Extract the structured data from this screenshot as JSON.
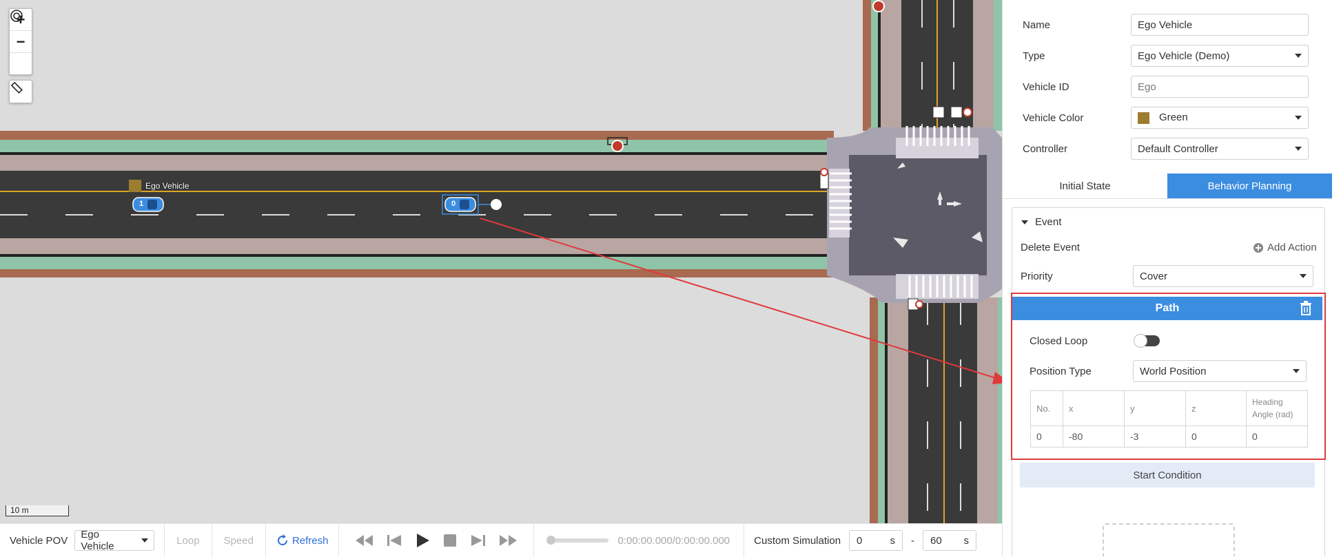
{
  "map": {
    "zoom_in": "+",
    "zoom_out": "−",
    "scale_label": "10 m",
    "ego_label": "Ego Vehicle",
    "vehicle_numbers": [
      "1",
      "0"
    ]
  },
  "bottom_bar": {
    "pov_label": "Vehicle POV",
    "pov_value": "Ego Vehicle",
    "loop_label": "Loop",
    "speed_label": "Speed",
    "refresh_label": "Refresh",
    "time_display": "0:00:00.000/0:00:00.000",
    "custom_sim_label": "Custom Simulation",
    "start_value": "0",
    "start_unit": "s",
    "separator": "-",
    "end_value": "60",
    "end_unit": "s",
    "progress": 0
  },
  "panel": {
    "name_label": "Name",
    "name_value": "Ego Vehicle",
    "type_label": "Type",
    "type_value": "Ego Vehicle (Demo)",
    "vehicle_id_label": "Vehicle ID",
    "vehicle_id_placeholder": "Ego",
    "vehicle_color_label": "Vehicle Color",
    "vehicle_color_value": "Green",
    "vehicle_color_hex": "#9c7c2e",
    "controller_label": "Controller",
    "controller_value": "Default Controller",
    "tabs": [
      {
        "label": "Initial State",
        "active": false
      },
      {
        "label": "Behavior Planning",
        "active": true
      }
    ],
    "event_label": "Event",
    "delete_event_label": "Delete Event",
    "add_action_label": "Add Action",
    "priority_label": "Priority",
    "priority_value": "Cover",
    "path_title": "Path",
    "closed_loop_label": "Closed Loop",
    "closed_loop_on": false,
    "position_type_label": "Position Type",
    "position_type_value": "World Position",
    "table_headers": [
      "No.",
      "x",
      "y",
      "z",
      "Heading Angle (rad)"
    ],
    "table_rows": [
      [
        "0",
        "-80",
        "-3",
        "0",
        "0"
      ]
    ],
    "start_condition_label": "Start Condition"
  },
  "colors": {
    "accent": "#3b8de0",
    "highlight": "#e0393a"
  }
}
